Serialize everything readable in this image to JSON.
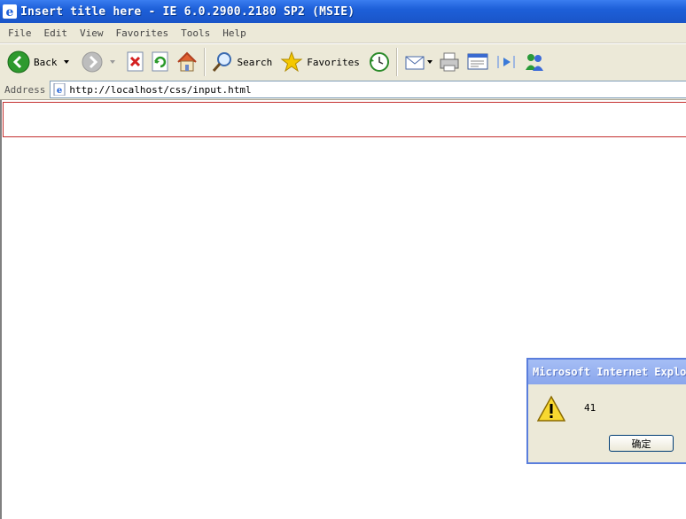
{
  "window": {
    "title": "Insert title here - IE 6.0.2900.2180 SP2 (MSIE)"
  },
  "menu": [
    "File",
    "Edit",
    "View",
    "Favorites",
    "Tools",
    "Help"
  ],
  "toolbar": {
    "back_label": "Back",
    "search_label": "Search",
    "favorites_label": "Favorites"
  },
  "address": {
    "label": "Address",
    "url": "http://localhost/css/input.html"
  },
  "alert": {
    "title": "Microsoft Internet Explorer",
    "message": "41",
    "ok_label": "确定"
  },
  "colors": {
    "input_border": "#c4302f",
    "titlebar": "#1d5fd8"
  }
}
